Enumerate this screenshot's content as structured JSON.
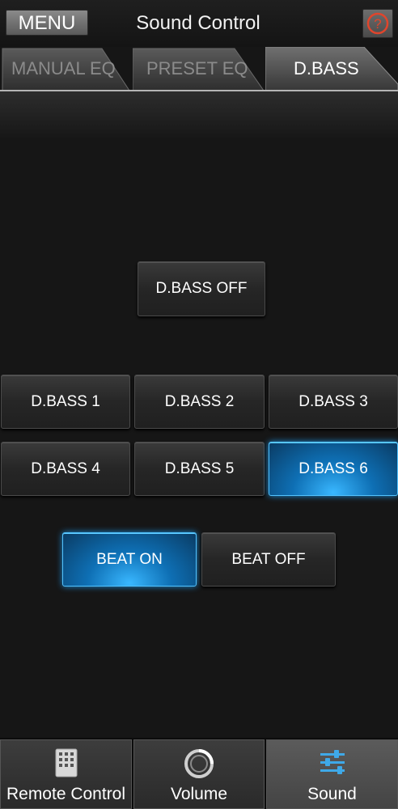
{
  "header": {
    "menu_label": "MENU",
    "title": "Sound Control",
    "help_symbol": "?"
  },
  "tabs": [
    {
      "label": "MANUAL EQ",
      "active": false
    },
    {
      "label": "PRESET EQ",
      "active": false
    },
    {
      "label": "D.BASS",
      "active": true
    }
  ],
  "dbass": {
    "off_label": "D.BASS OFF",
    "levels": [
      {
        "label": "D.BASS 1",
        "selected": false
      },
      {
        "label": "D.BASS 2",
        "selected": false
      },
      {
        "label": "D.BASS 3",
        "selected": false
      },
      {
        "label": "D.BASS 4",
        "selected": false
      },
      {
        "label": "D.BASS 5",
        "selected": false
      },
      {
        "label": "D.BASS 6",
        "selected": true
      }
    ]
  },
  "beat": {
    "on_label": "BEAT ON",
    "off_label": "BEAT OFF",
    "state": "on"
  },
  "bottom_nav": [
    {
      "label": "Remote Control",
      "icon": "remote-icon",
      "selected": false
    },
    {
      "label": "Volume",
      "icon": "volume-knob-icon",
      "selected": false
    },
    {
      "label": "Sound",
      "icon": "equalizer-icon",
      "selected": true
    }
  ],
  "colors": {
    "accent_blue": "#1c8fdc",
    "help_icon_red": "#e0452c",
    "background": "#161616"
  }
}
